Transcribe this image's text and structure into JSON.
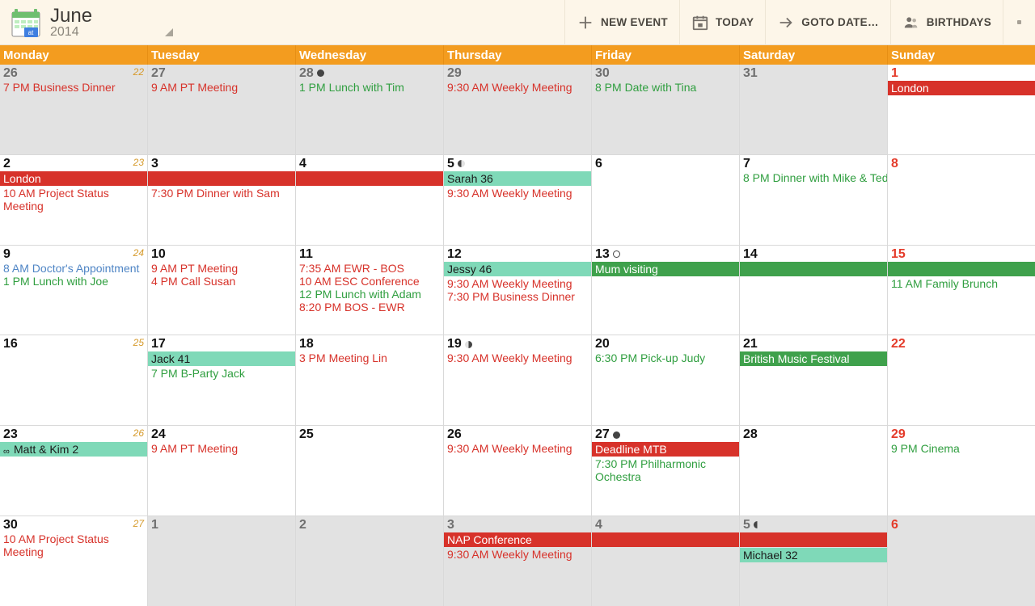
{
  "header": {
    "month": "June",
    "year": "2014",
    "buttons": {
      "new_event": "NEW EVENT",
      "today": "TODAY",
      "goto_date": "GOTO DATE…",
      "birthdays": "BIRTHDAYS"
    }
  },
  "day_headers": [
    "Monday",
    "Tuesday",
    "Wednesday",
    "Thursday",
    "Friday",
    "Saturday",
    "Sunday"
  ],
  "weeks": [
    {
      "cells": [
        {
          "num": "26",
          "dim": true,
          "out": true,
          "weeknum": "22",
          "events": [
            {
              "t": "7 PM Business Dinner",
              "c": "red"
            }
          ]
        },
        {
          "num": "27",
          "dim": true,
          "out": true,
          "events": [
            {
              "t": "9 AM PT Meeting",
              "c": "red"
            }
          ]
        },
        {
          "num": "28",
          "dim": true,
          "out": true,
          "moon": "full",
          "events": [
            {
              "t": "1 PM Lunch with Tim",
              "c": "green"
            }
          ]
        },
        {
          "num": "29",
          "dim": true,
          "out": true,
          "events": [
            {
              "t": "9:30 AM Weekly Meeting",
              "c": "red"
            }
          ]
        },
        {
          "num": "30",
          "dim": true,
          "out": true,
          "events": [
            {
              "t": "8 PM Date with Tina",
              "c": "green"
            }
          ]
        },
        {
          "num": "31",
          "dim": true,
          "out": true,
          "events": []
        },
        {
          "num": "1",
          "sun": true,
          "bars": [
            {
              "t": "London",
              "c": "red",
              "arrow": true
            }
          ],
          "events": []
        }
      ]
    },
    {
      "cells": [
        {
          "num": "2",
          "weeknum": "23",
          "bars": [
            {
              "t": "London",
              "c": "red",
              "span": "start"
            }
          ],
          "events": [
            {
              "t": "10 AM Project Status Meeting",
              "c": "red",
              "wrap": true
            }
          ]
        },
        {
          "num": "3",
          "bars": [
            {
              "t": "",
              "c": "red",
              "span": "mid"
            }
          ],
          "events": [
            {
              "t": "7:30 PM Dinner with Sam",
              "c": "red"
            }
          ]
        },
        {
          "num": "4",
          "bars": [
            {
              "t": "",
              "c": "red",
              "span": "end"
            }
          ],
          "events": []
        },
        {
          "num": "5",
          "moon": "half",
          "bars": [
            {
              "t": "Sarah 36",
              "c": "mint"
            }
          ],
          "events": [
            {
              "t": "9:30 AM Weekly Meeting",
              "c": "red"
            }
          ]
        },
        {
          "num": "6",
          "events": []
        },
        {
          "num": "7",
          "events": [
            {
              "t": "8 PM Dinner with Mike & Ted",
              "c": "green"
            }
          ]
        },
        {
          "num": "8",
          "sun": true,
          "events": []
        }
      ]
    },
    {
      "cells": [
        {
          "num": "9",
          "weeknum": "24",
          "events": [
            {
              "t": "8 AM Doctor's Appointment",
              "c": "blue"
            },
            {
              "t": "1 PM Lunch with Joe",
              "c": "green"
            }
          ]
        },
        {
          "num": "10",
          "events": [
            {
              "t": "9 AM PT Meeting",
              "c": "red"
            },
            {
              "t": "4 PM Call Susan",
              "c": "red"
            }
          ]
        },
        {
          "num": "11",
          "events": [
            {
              "t": "7:35 AM EWR - BOS",
              "c": "red"
            },
            {
              "t": "10 AM ESC Conference",
              "c": "red"
            },
            {
              "t": "12 PM Lunch with Adam",
              "c": "green"
            },
            {
              "t": "8:20 PM BOS - EWR",
              "c": "red"
            }
          ]
        },
        {
          "num": "12",
          "bars": [
            {
              "t": "Jessy 46",
              "c": "mint"
            }
          ],
          "events": [
            {
              "t": "9:30 AM Weekly Meeting",
              "c": "red"
            },
            {
              "t": "7:30 PM Business Dinner",
              "c": "red"
            }
          ]
        },
        {
          "num": "13",
          "moon": "ring",
          "bars": [
            {
              "t": "Mum visiting",
              "c": "green",
              "span": "start"
            }
          ],
          "events": []
        },
        {
          "num": "14",
          "bars": [
            {
              "t": "",
              "c": "green",
              "span": "mid"
            }
          ],
          "events": []
        },
        {
          "num": "15",
          "sun": true,
          "bars": [
            {
              "t": "",
              "c": "green",
              "span": "end",
              "arrow": true
            }
          ],
          "events": [
            {
              "t": "11 AM Family Brunch",
              "c": "green"
            }
          ]
        }
      ]
    },
    {
      "cells": [
        {
          "num": "16",
          "weeknum": "25",
          "events": []
        },
        {
          "num": "17",
          "bars": [
            {
              "t": "Jack 41",
              "c": "mint"
            }
          ],
          "events": [
            {
              "t": "7 PM B-Party Jack",
              "c": "green"
            }
          ]
        },
        {
          "num": "18",
          "events": [
            {
              "t": "3 PM Meeting Lin",
              "c": "red"
            }
          ]
        },
        {
          "num": "19",
          "moon": "half-r",
          "events": [
            {
              "t": "9:30 AM Weekly Meeting",
              "c": "red"
            }
          ]
        },
        {
          "num": "20",
          "events": [
            {
              "t": "6:30 PM Pick-up Judy",
              "c": "green"
            }
          ]
        },
        {
          "num": "21",
          "bars": [
            {
              "t": "British Music Festival",
              "c": "green"
            }
          ],
          "events": []
        },
        {
          "num": "22",
          "sun": true,
          "events": []
        }
      ]
    },
    {
      "cells": [
        {
          "num": "23",
          "weeknum": "26",
          "bars": [
            {
              "t": "Matt & Kim 2",
              "c": "mint",
              "rep": true
            }
          ],
          "events": []
        },
        {
          "num": "24",
          "events": [
            {
              "t": "9 AM PT Meeting",
              "c": "red"
            }
          ]
        },
        {
          "num": "25",
          "events": []
        },
        {
          "num": "26",
          "events": [
            {
              "t": "9:30 AM Weekly Meeting",
              "c": "red"
            }
          ]
        },
        {
          "num": "27",
          "moon": "full",
          "bars": [
            {
              "t": "Deadline MTB",
              "c": "red"
            }
          ],
          "events": [
            {
              "t": "7:30 PM Philharmonic Ochestra",
              "c": "green",
              "wrap": true
            }
          ]
        },
        {
          "num": "28",
          "events": []
        },
        {
          "num": "29",
          "sun": true,
          "events": [
            {
              "t": "9 PM Cinema",
              "c": "green"
            }
          ]
        }
      ]
    },
    {
      "cells": [
        {
          "num": "30",
          "weeknum": "27",
          "events": [
            {
              "t": "10 AM Project Status Meeting",
              "c": "red",
              "wrap": true
            }
          ]
        },
        {
          "num": "1",
          "dim": true,
          "out": true,
          "events": []
        },
        {
          "num": "2",
          "dim": true,
          "out": true,
          "events": []
        },
        {
          "num": "3",
          "dim": true,
          "out": true,
          "bars": [
            {
              "t": "NAP Conference",
              "c": "red",
              "span": "start"
            }
          ],
          "events": [
            {
              "t": "9:30 AM Weekly Meeting",
              "c": "red"
            }
          ]
        },
        {
          "num": "4",
          "dim": true,
          "out": true,
          "bars": [
            {
              "t": "",
              "c": "red",
              "span": "mid"
            }
          ],
          "events": []
        },
        {
          "num": "5",
          "dim": true,
          "out": true,
          "moon": "half",
          "bars": [
            {
              "t": "",
              "c": "red",
              "span": "end"
            },
            {
              "t": "Michael 32",
              "c": "mint"
            }
          ],
          "events": []
        },
        {
          "num": "6",
          "dim": true,
          "out": true,
          "sun": true,
          "events": []
        }
      ]
    }
  ]
}
